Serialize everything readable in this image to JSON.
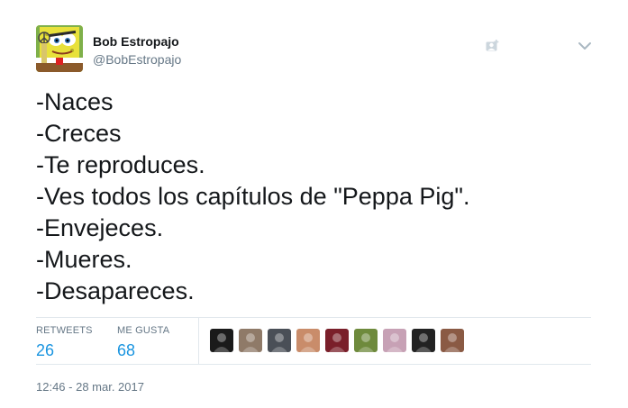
{
  "author": {
    "name": "Bob Estropajo",
    "handle": "@BobEstropajo",
    "avatar_icon": "spongebob-avatar-icon"
  },
  "header_icons": {
    "follow": "follow-user-icon",
    "menu": "chevron-down-icon"
  },
  "tweet": {
    "lines": [
      "-Naces",
      "-Creces",
      "-Te reproduces.",
      "-Ves todos los capítulos de \"Peppa Pig\".",
      "-Envejeces.",
      "-Mueres.",
      "-Desapareces."
    ]
  },
  "stats": {
    "retweets_label": "RETWEETS",
    "retweets_value": "26",
    "likes_label": "ME GUSTA",
    "likes_value": "68"
  },
  "likers": [
    {
      "name": "liker-avatar-1",
      "color": "#1a1a1a"
    },
    {
      "name": "liker-avatar-2",
      "color": "#8f7a68"
    },
    {
      "name": "liker-avatar-3",
      "color": "#4a4f57"
    },
    {
      "name": "liker-avatar-4",
      "color": "#c98c6a"
    },
    {
      "name": "liker-avatar-5",
      "color": "#7a1f2a"
    },
    {
      "name": "liker-avatar-6",
      "color": "#6e8a3c"
    },
    {
      "name": "liker-avatar-7",
      "color": "#c7a1b5"
    },
    {
      "name": "liker-avatar-8",
      "color": "#222222"
    },
    {
      "name": "liker-avatar-9",
      "color": "#8a5a44"
    }
  ],
  "timestamp": "12:46 - 28 mar. 2017",
  "colors": {
    "link_blue": "#1b95e0",
    "muted": "#657786",
    "text": "#14171a",
    "border": "#e1e8ed"
  }
}
